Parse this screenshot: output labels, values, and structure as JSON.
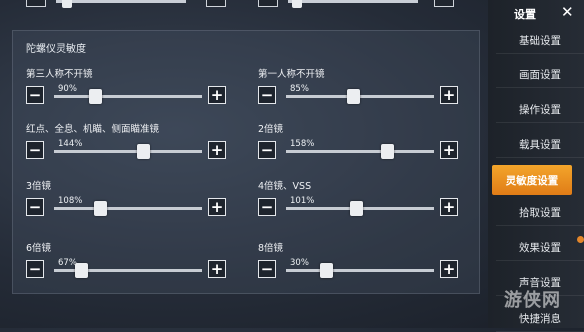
{
  "panel": {
    "title": "陀螺仪灵敏度",
    "items": [
      {
        "label": "第三人称不开镜",
        "percent": "90%",
        "value": 0.28
      },
      {
        "label": "第一人称不开镜",
        "percent": "85%",
        "value": 0.45
      },
      {
        "label": "红点、全息、机瞄、侧面瞄准镜",
        "percent": "144%",
        "value": 0.6
      },
      {
        "label": "2倍镜",
        "percent": "158%",
        "value": 0.68
      },
      {
        "label": "3倍镜",
        "percent": "108%",
        "value": 0.31
      },
      {
        "label": "4倍镜、VSS",
        "percent": "101%",
        "value": 0.47
      },
      {
        "label": "6倍镜",
        "percent": "67%",
        "value": 0.18
      },
      {
        "label": "8倍镜",
        "percent": "30%",
        "value": 0.27
      }
    ],
    "minus": "−",
    "plus": "+"
  },
  "sidebar": {
    "title": "设置",
    "close": "✕",
    "items": [
      {
        "label": "基础设置"
      },
      {
        "label": "画面设置"
      },
      {
        "label": "操作设置"
      },
      {
        "label": "载具设置"
      },
      {
        "label": "灵敏度设置",
        "active": true
      },
      {
        "label": "拾取设置"
      },
      {
        "label": "效果设置"
      },
      {
        "label": "声音设置"
      },
      {
        "label": "快捷消息"
      }
    ]
  },
  "watermark": "游侠网",
  "colors": {
    "accent": "#e8891d",
    "track": "#c7ccd3"
  }
}
